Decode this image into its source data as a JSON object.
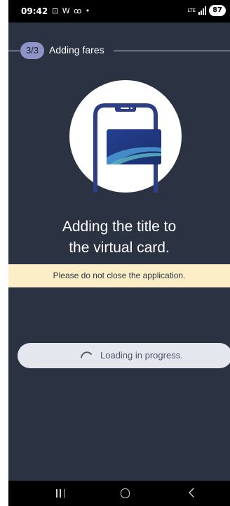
{
  "status_bar": {
    "time": "09:42",
    "left_icons": "⊡ W ꝏ •",
    "network": "LTE",
    "battery": "87"
  },
  "header": {
    "step": "3/3",
    "title": "Adding fares"
  },
  "main": {
    "title_line1": "Adding the title to",
    "title_line2": "the virtual card.",
    "warning": "Please do not close the application.",
    "loading_text": "Loading in progress."
  },
  "icons": {
    "illustration": "phone-with-card-illustration",
    "spinner": "loading-spinner-icon",
    "nav": [
      "recent-apps-icon",
      "home-icon",
      "back-icon"
    ]
  },
  "colors": {
    "background": "#2b3343",
    "badge": "#8f94c8",
    "warning_bg": "#fcefc7",
    "pill_bg": "#e4e7ee",
    "phone_frame": "#2c3f86",
    "card": "#2e57a8"
  }
}
